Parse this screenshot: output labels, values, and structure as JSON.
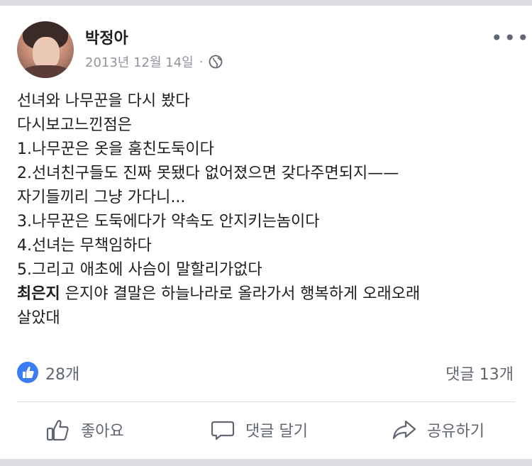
{
  "post": {
    "author": "박정아",
    "date": "2013년 12월 14일",
    "separator": "·",
    "privacy_icon": "globe-icon",
    "more_icon": "more-icon",
    "lines": [
      "선녀와 나무꾼을 다시 봤다",
      "다시보고느낀점은",
      "1.나무꾼은 옷을 훔친도둑이다",
      "2.선녀친구들도 진짜 못됐다 없어졌으면 갖다주면되지——",
      "자기들끼리 그냥 가다니...",
      "3.나무꾼은 도둑에다가 약속도 안지키는놈이다",
      "4.선녀는 무책임하다",
      "5.그리고 애초에 사슴이 말할리가없다"
    ],
    "mention_name": "최은지",
    "mention_text": " 은지야 결말은 하늘나라로 올라가서 행복하게 오래오래",
    "last_line": "살았대"
  },
  "reactions": {
    "like_count": "28개",
    "comment_count": "댓글 13개",
    "like_color": "#3b7cf0"
  },
  "actions": {
    "like": "좋아요",
    "comment": "댓글 달기",
    "share": "공유하기"
  }
}
